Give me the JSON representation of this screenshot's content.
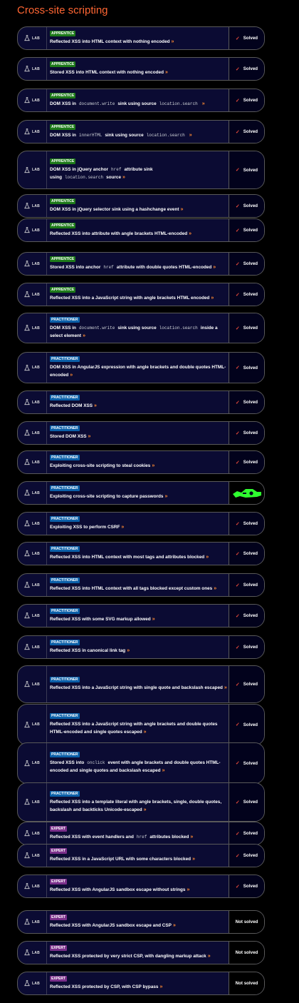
{
  "page": {
    "title": "Cross-site scripting"
  },
  "badge_label": "LAB",
  "colors": {
    "title": "#ff6633",
    "apprentice": "#1e7a1a",
    "practitioner": "#0b5fa8",
    "expert": "#7a2f8a",
    "check": "#e64a3c",
    "highlight": "#2fff2f"
  },
  "labs": [
    {
      "level": "APPRENTICE",
      "status": "Solved",
      "title": [
        {
          "t": "Reflected XSS into HTML context with nothing encoded"
        }
      ]
    },
    {
      "level": "APPRENTICE",
      "status": "Solved",
      "title": [
        {
          "t": "Stored XSS into HTML context with nothing encoded"
        }
      ]
    },
    {
      "level": "APPRENTICE",
      "status": "Solved",
      "title": [
        {
          "t": "DOM XSS in"
        },
        {
          "c": "document.write"
        },
        {
          "t": "sink using source"
        },
        {
          "c": "location.search"
        }
      ]
    },
    {
      "level": "APPRENTICE",
      "status": "Solved",
      "title": [
        {
          "t": "DOM XSS in"
        },
        {
          "c": "innerHTML"
        },
        {
          "t": "sink using source"
        },
        {
          "c": "location.search"
        }
      ]
    },
    {
      "level": "APPRENTICE",
      "status": "Solved",
      "title": [
        {
          "t": "DOM XSS in jQuery anchor"
        },
        {
          "c": "href"
        },
        {
          "t": "attribute sink using"
        },
        {
          "c": "location.search"
        },
        {
          "t": "source"
        }
      ]
    },
    {
      "level": "APPRENTICE",
      "status": "Solved",
      "title": [
        {
          "t": "DOM XSS in jQuery selector sink using a hashchange event"
        }
      ]
    },
    {
      "level": "APPRENTICE",
      "status": "Solved",
      "title": [
        {
          "t": "Reflected XSS into attribute with angle brackets HTML-encoded"
        }
      ]
    },
    {
      "level": "APPRENTICE",
      "status": "Solved",
      "title": [
        {
          "t": "Stored XSS into anchor"
        },
        {
          "c": "href"
        },
        {
          "t": "attribute with double quotes HTML-encoded"
        }
      ]
    },
    {
      "level": "APPRENTICE",
      "status": "Solved",
      "title": [
        {
          "t": "Reflected XSS into a JavaScript string with angle brackets HTML encoded"
        }
      ]
    },
    {
      "level": "PRACTITIONER",
      "status": "Solved",
      "title": [
        {
          "t": "DOM XSS in"
        },
        {
          "c": "document.write"
        },
        {
          "t": "sink using source"
        },
        {
          "c": "location.search"
        },
        {
          "t": "inside a select element"
        }
      ]
    },
    {
      "level": "PRACTITIONER",
      "status": "Solved",
      "title": [
        {
          "t": "DOM XSS in AngularJS expression with angle brackets and double quotes HTML-encoded"
        }
      ]
    },
    {
      "level": "PRACTITIONER",
      "status": "Solved",
      "title": [
        {
          "t": "Reflected DOM XSS"
        }
      ]
    },
    {
      "level": "PRACTITIONER",
      "status": "Solved",
      "title": [
        {
          "t": "Stored DOM XSS"
        }
      ]
    },
    {
      "level": "PRACTITIONER",
      "status": "Solved",
      "title": [
        {
          "t": "Exploiting cross-site scripting to steal cookies"
        }
      ]
    },
    {
      "level": "PRACTITIONER",
      "status": "highlight",
      "title": [
        {
          "t": "Exploiting cross-site scripting to capture passwords"
        }
      ]
    },
    {
      "level": "PRACTITIONER",
      "status": "Solved",
      "title": [
        {
          "t": "Exploiting XSS to perform CSRF"
        }
      ]
    },
    {
      "level": "PRACTITIONER",
      "status": "Solved",
      "title": [
        {
          "t": "Reflected XSS into HTML context with most tags and attributes blocked"
        }
      ]
    },
    {
      "level": "PRACTITIONER",
      "status": "Solved",
      "title": [
        {
          "t": "Reflected XSS into HTML context with all tags blocked except custom ones"
        }
      ]
    },
    {
      "level": "PRACTITIONER",
      "status": "Solved",
      "title": [
        {
          "t": "Reflected XSS with some SVG markup allowed"
        }
      ]
    },
    {
      "level": "PRACTITIONER",
      "status": "Solved",
      "title": [
        {
          "t": "Reflected XSS in canonical link tag"
        }
      ]
    },
    {
      "level": "PRACTITIONER",
      "status": "Solved",
      "title": [
        {
          "t": "Reflected XSS into a JavaScript string with single quote and backslash escaped"
        }
      ]
    },
    {
      "level": "PRACTITIONER",
      "status": "Solved",
      "title": [
        {
          "t": "Reflected XSS into a JavaScript string with angle brackets and double quotes HTML-encoded and single quotes escaped"
        }
      ]
    },
    {
      "level": "PRACTITIONER",
      "status": "Solved",
      "title": [
        {
          "t": "Stored XSS into"
        },
        {
          "c": "onclick"
        },
        {
          "t": "event with angle brackets and double quotes HTML-encoded and single quotes and backslash escaped"
        }
      ]
    },
    {
      "level": "PRACTITIONER",
      "status": "Solved",
      "title": [
        {
          "t": "Reflected XSS into a template literal with angle brackets, single, double quotes, backslash and backticks Unicode-escaped"
        }
      ]
    },
    {
      "level": "EXPERT",
      "status": "Solved",
      "title": [
        {
          "t": "Reflected XSS with event handlers and"
        },
        {
          "c": "href"
        },
        {
          "t": "attributes blocked"
        }
      ]
    },
    {
      "level": "EXPERT",
      "status": "Solved",
      "title": [
        {
          "t": "Reflected XSS in a JavaScript URL with some characters blocked"
        }
      ]
    },
    {
      "level": "EXPERT",
      "status": "Solved",
      "title": [
        {
          "t": "Reflected XSS with AngularJS sandbox escape without strings"
        }
      ]
    },
    {
      "level": "EXPERT",
      "status": "Not solved",
      "title": [
        {
          "t": "Reflected XSS with AngularJS sandbox escape and CSP"
        }
      ]
    },
    {
      "level": "EXPERT",
      "status": "Not solved",
      "title": [
        {
          "t": "Reflected XSS protected by very strict CSP, with dangling markup attack"
        }
      ]
    },
    {
      "level": "EXPERT",
      "status": "Not solved",
      "title": [
        {
          "t": "Reflected XSS protected by CSP, with CSP bypass"
        }
      ]
    }
  ]
}
